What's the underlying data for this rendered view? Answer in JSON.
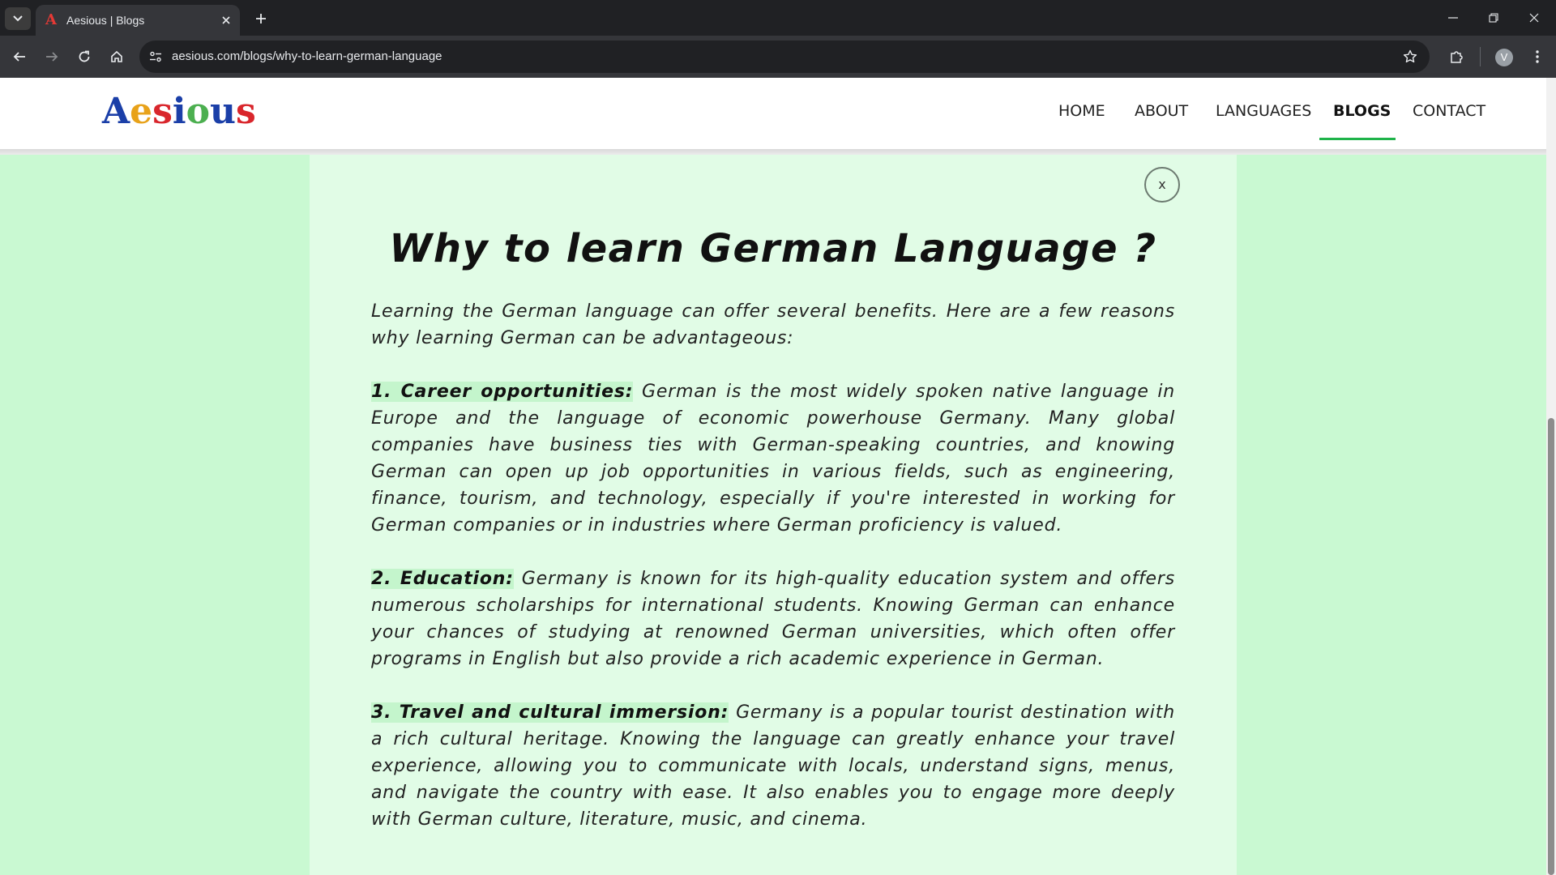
{
  "browser": {
    "tab_title": "Aesious | Blogs",
    "tab_favicon_letter": "A",
    "url": "aesious.com/blogs/why-to-learn-german-language",
    "profile_initial": "V",
    "icons": [
      "tab-list-icon",
      "close-icon",
      "plus-icon",
      "minimize-icon",
      "restore-icon",
      "window-close-icon",
      "back-arrow-icon",
      "forward-arrow-icon",
      "reload-icon",
      "home-icon",
      "site-info-icon",
      "star-icon",
      "puzzle-icon",
      "kebab-menu-icon"
    ]
  },
  "site": {
    "logo_letters": [
      "A",
      "e",
      "s",
      "i",
      "o",
      "u",
      "s"
    ],
    "logo_colors": [
      "#1b3fa8",
      "#e8a21a",
      "#d9262c",
      "#1b3fa8",
      "#4caf50",
      "#1b3fa8",
      "#d9262c"
    ],
    "nav": {
      "home": "HOME",
      "about": "ABOUT",
      "languages": "LANGUAGES",
      "blogs": "BLOGS",
      "contact": "CONTACT"
    },
    "active_nav": "BLOGS",
    "accent_color": "#1fb34a"
  },
  "article": {
    "close_label": "x",
    "title": "Why to learn German Language ?",
    "intro": "Learning the German language can offer several benefits. Here are a few reasons why learning German can be advantageous:",
    "points": [
      {
        "heading": "1. Career opportunities:",
        "text": "German is the most widely spoken native language in Europe and the language of economic powerhouse Germany. Many global companies have business ties with German-speaking countries, and knowing German can open up job opportunities in various fields, such as engineering, finance, tourism, and technology, especially if you're interested in working for German companies or in industries where German proficiency is valued."
      },
      {
        "heading": "2. Education:",
        "text": "Germany is known for its high-quality education system and offers numerous scholarships for international students. Knowing German can enhance your chances of studying at renowned German universities, which often offer programs in English but also provide a rich academic experience in German."
      },
      {
        "heading": "3. Travel and cultural immersion:",
        "text": "Germany is a popular tourist destination with a rich cultural heritage. Knowing the language can greatly enhance your travel experience, allowing you to communicate with locals, understand signs, menus, and navigate the country with ease. It also enables you to engage more deeply with German culture, literature, music, and cinema."
      }
    ]
  }
}
